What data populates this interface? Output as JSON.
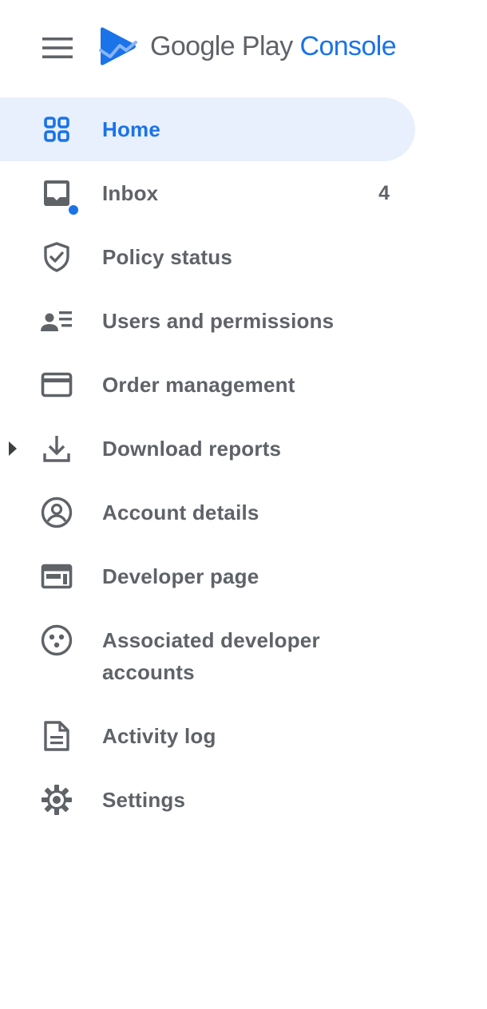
{
  "header": {
    "logo_google_play": "Google Play",
    "logo_console": "Console"
  },
  "nav": {
    "items": [
      {
        "label": "Home",
        "icon": "dashboard-grid-icon",
        "active": true
      },
      {
        "label": "Inbox",
        "icon": "inbox-icon",
        "badge": "4",
        "unread_dot": true
      },
      {
        "label": "Policy status",
        "icon": "shield-check-icon"
      },
      {
        "label": "Users and permissions",
        "icon": "users-list-icon"
      },
      {
        "label": "Order management",
        "icon": "credit-card-icon"
      },
      {
        "label": "Download reports",
        "icon": "download-icon",
        "expandable": true
      },
      {
        "label": "Account details",
        "icon": "account-circle-icon"
      },
      {
        "label": "Developer page",
        "icon": "web-page-icon"
      },
      {
        "label": "Associated developer accounts",
        "icon": "linked-accounts-icon"
      },
      {
        "label": "Activity log",
        "icon": "document-icon"
      },
      {
        "label": "Settings",
        "icon": "gear-icon"
      }
    ]
  },
  "colors": {
    "accent": "#1a73e8",
    "active_bg": "#e8f0fe",
    "text": "#5f6368"
  }
}
